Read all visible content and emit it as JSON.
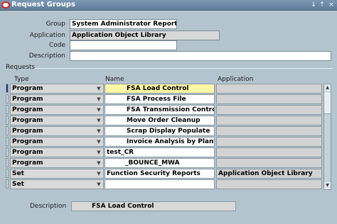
{
  "window": {
    "title": "Request Groups",
    "controls": [
      "↓",
      "↑",
      "×"
    ]
  },
  "header": {
    "group_label": "Group",
    "group_value": "System Administrator Reports",
    "application_label": "Application",
    "application_value": "Application Object Library",
    "code_label": "Code",
    "code_value": "",
    "description_label": "Description",
    "description_value": ""
  },
  "requests": {
    "section_label": "Requests",
    "columns": {
      "type": "Type",
      "name": "Name",
      "application": "Application"
    },
    "rows": [
      {
        "type": "Program",
        "name": "FSA Load Control",
        "application": ""
      },
      {
        "type": "Program",
        "name": "FSA Process File",
        "application": ""
      },
      {
        "type": "Program",
        "name": "FSA Transmission Control",
        "application": ""
      },
      {
        "type": "Program",
        "name": "Move Order Cleanup",
        "application": ""
      },
      {
        "type": "Program",
        "name": "Scrap Display Populate",
        "application": ""
      },
      {
        "type": "Program",
        "name": "Invoice Analysis by Plant",
        "application": ""
      },
      {
        "type": "Program",
        "name": "test_CR",
        "application": ""
      },
      {
        "type": "Program",
        "name": "_BOUNCE_MWA",
        "application": ""
      },
      {
        "type": "Set",
        "name": "Function Security Reports",
        "application": "Application Object Library"
      },
      {
        "type": "Set",
        "name": "",
        "application": ""
      }
    ]
  },
  "footer": {
    "description_label": "Description",
    "description_value": "FSA Load Control"
  },
  "colors": {
    "background": "#b4c4ce",
    "titlebar": "#6b89a6",
    "selected_row": "#fff7a6",
    "current_record_marker": "#1e3a8c"
  }
}
